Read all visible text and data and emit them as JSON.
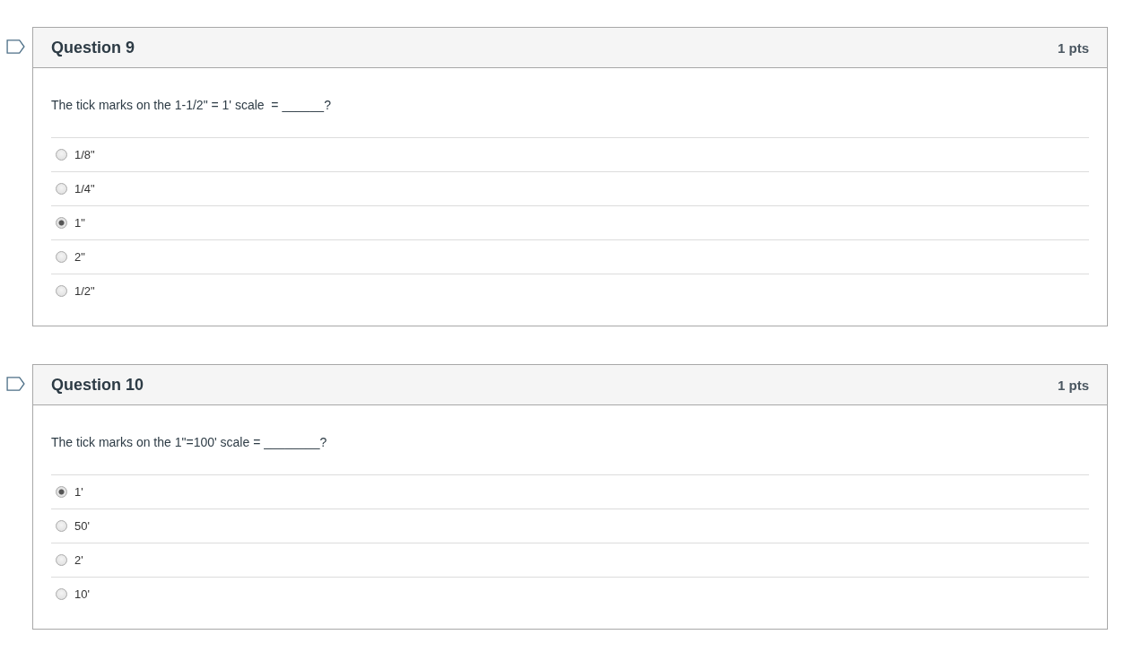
{
  "questions": [
    {
      "title": "Question 9",
      "points": "1 pts",
      "flagged": false,
      "text": "The tick marks on the 1-1/2\" = 1' scale  = ______?",
      "answers": [
        {
          "label": "1/8\"",
          "selected": false
        },
        {
          "label": "1/4\"",
          "selected": false
        },
        {
          "label": "1\"",
          "selected": true
        },
        {
          "label": "2\"",
          "selected": false
        },
        {
          "label": "1/2\"",
          "selected": false
        }
      ]
    },
    {
      "title": "Question 10",
      "points": "1 pts",
      "flagged": false,
      "text": "The tick marks on the 1\"=100' scale = ________?",
      "answers": [
        {
          "label": "1'",
          "selected": true
        },
        {
          "label": "50'",
          "selected": false
        },
        {
          "label": "2'",
          "selected": false
        },
        {
          "label": "10'",
          "selected": false
        }
      ]
    }
  ]
}
